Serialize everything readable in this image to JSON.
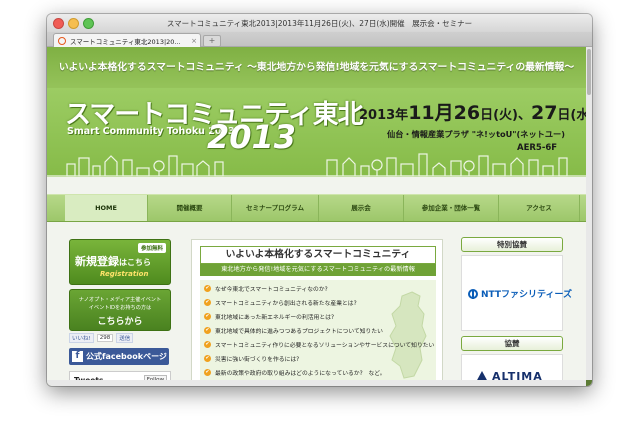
{
  "window": {
    "title": "スマートコミュニティ東北2013|2013年11月26日(火)、27日(水)開催　展示会・セミナー",
    "tab_label": "スマートコミュニティ東北2013|20...",
    "tab_close": "×",
    "new_tab": "+"
  },
  "header": {
    "tagline": "いよいよ本格化するスマートコミュニティ ～東北地方から発信!地域を元気にするスマートコミュニティの最新情報～",
    "logo_title": "スマートコミュニティ東北",
    "logo_subtitle": "Smart Community Tohoku 2013",
    "logo_year": "2013",
    "date_prefix": "2013年",
    "date_day1": "11月26",
    "date_day1_suffix": "日(火)、",
    "date_day2": "27",
    "date_day2_suffix": "日(水)",
    "venue": "仙台・情報産業プラザ \"ネ!ッtoU\"(ネットユー)",
    "room": "AER5-6F"
  },
  "nav": {
    "items": [
      {
        "label": "HOME"
      },
      {
        "label": "開催概要"
      },
      {
        "label": "セミナープログラム"
      },
      {
        "label": "展示会"
      },
      {
        "label": "参加企業・団体一覧"
      },
      {
        "label": "アクセス"
      }
    ]
  },
  "left": {
    "register_badge": "参加無料",
    "register_main": "新規登録",
    "register_main_small": "はこちら",
    "register_sub": "Registration",
    "promo_line1": "ナノオプト・メディア主催イベント",
    "promo_line2": "イベントIDをお持ちの方は",
    "promo_line3": "こちらから",
    "like_label": "いいね!",
    "like_count": "298",
    "send_label": "送信",
    "facebook_label": "公式facebookページ",
    "tweets_title": "Tweets",
    "follow_label": "Follow"
  },
  "feature": {
    "title": "いよいよ本格化するスマートコミュニティ",
    "subtitle": "東北地方から発信!地域を元気にするスマートコミュニティの最新情報",
    "items": [
      "なぜ今東北でスマートコミュニティなのか?",
      "スマートコミュニティから創出される新たな産業とは?",
      "東北地域にあった新エネルギーの利活用とは?",
      "東北地域で具体的に進みつつあるプロジェクトについて知りたい",
      "スマートコミュニティ作りに必要となるソリューションやサービスについて知りたい",
      "災害に強い街づくりを作るには?",
      "最新の政策や政府の取り組みはどのようになっているか?　など。"
    ]
  },
  "sponsors": {
    "special_label": "特別協賛",
    "special_name": "NTTファシリティーズ",
    "support_label": "協賛",
    "support_name": "ALTIMA"
  }
}
